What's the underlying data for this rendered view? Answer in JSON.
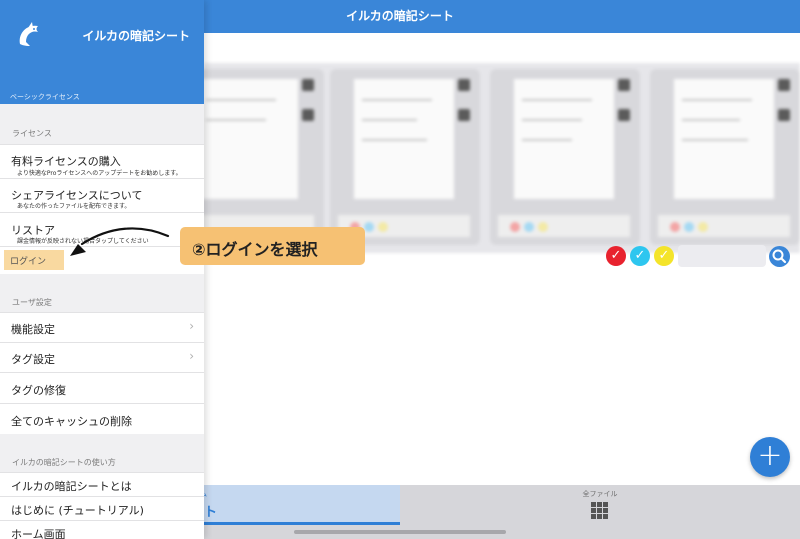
{
  "app": {
    "title": "イルカの暗記シート"
  },
  "sidebar": {
    "title": "イルカの暗記シート",
    "license_badge": "ベーシックライセンス",
    "sections": {
      "license": "ライセンス",
      "user_settings": "ユーザ設定",
      "howto": "イルカの暗記シートの使い方"
    },
    "items": {
      "purchase": {
        "label": "有料ライセンスの購入",
        "sub": "より快適なProライセンスへのアップデートをお勧めします。"
      },
      "share": {
        "label": "シェアライセンスについて",
        "sub": "あなたの作ったファイルを配布できます。"
      },
      "restore": {
        "label": "リストア",
        "sub": "課金情報が反映されない場合タップしてください"
      },
      "login": {
        "label": "ログイン"
      },
      "features": {
        "label": "機能設定"
      },
      "tags": {
        "label": "タグ設定"
      },
      "tag_repair": {
        "label": "タグの修復"
      },
      "clear_cache": {
        "label": "全てのキャッシュの削除"
      },
      "what_is": {
        "label": "イルカの暗記シートとは"
      },
      "tutorial": {
        "label": "はじめに (チュートリアル)"
      },
      "home_screen": {
        "label": "ホーム画面"
      }
    }
  },
  "annotation": {
    "text": "②ログインを選択"
  },
  "filters": [
    {
      "color": "#e8222e",
      "icon": "check-icon"
    },
    {
      "color": "#2ec6ef",
      "icon": "check-icon"
    },
    {
      "color": "#f4e42a",
      "icon": "check-icon"
    }
  ],
  "tabbar": {
    "sheet": {
      "label": "ム",
      "glyph": "ト"
    },
    "all_files": {
      "label": "全ファイル"
    }
  },
  "fab": {
    "label": "+"
  },
  "colors": {
    "primary": "#3a86d8",
    "highlight": "#f6c173"
  }
}
